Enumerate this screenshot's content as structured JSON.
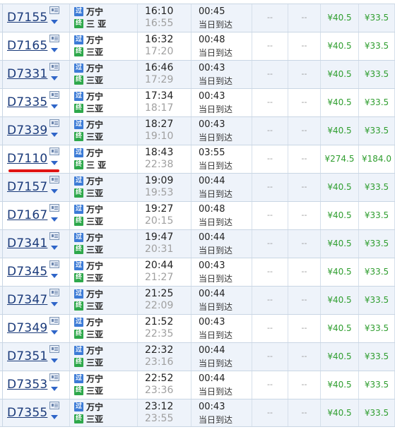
{
  "icons": {
    "card": "ticket-card-icon",
    "expand": "chevron-down-icon",
    "pass_badge": "过",
    "end_badge": "终"
  },
  "colors": {
    "train_link": "#1a3a7a",
    "price": "#2f9e2f",
    "arrival_time": "#a0a0a0",
    "highlight_underline": "#e01414",
    "badge_pass": "#3c7bd6",
    "badge_end": "#2ea84b"
  },
  "trains": [
    {
      "no": "D7155",
      "from": "万宁",
      "to": "三 亚",
      "dep": "16:10",
      "arr": "16:55",
      "dur": "00:45",
      "arr_day": "当日到达",
      "e1": "--",
      "e2": "--",
      "p1": "¥40.5",
      "p2": "¥33.5",
      "highlight": false
    },
    {
      "no": "D7165",
      "from": "万宁",
      "to": "三亚",
      "dep": "16:32",
      "arr": "17:20",
      "dur": "00:48",
      "arr_day": "当日到达",
      "e1": "--",
      "e2": "--",
      "p1": "¥40.5",
      "p2": "¥33.5",
      "highlight": false
    },
    {
      "no": "D7331",
      "from": "万宁",
      "to": "三亚",
      "dep": "16:46",
      "arr": "17:29",
      "dur": "00:43",
      "arr_day": "当日到达",
      "e1": "--",
      "e2": "--",
      "p1": "¥40.5",
      "p2": "¥33.5",
      "highlight": false
    },
    {
      "no": "D7335",
      "from": "万宁",
      "to": "三亚",
      "dep": "17:34",
      "arr": "18:17",
      "dur": "00:43",
      "arr_day": "当日到达",
      "e1": "--",
      "e2": "--",
      "p1": "¥40.5",
      "p2": "¥33.5",
      "highlight": false
    },
    {
      "no": "D7339",
      "from": "万宁",
      "to": "三亚",
      "dep": "18:27",
      "arr": "19:10",
      "dur": "00:43",
      "arr_day": "当日到达",
      "e1": "--",
      "e2": "--",
      "p1": "¥40.5",
      "p2": "¥33.5",
      "highlight": false
    },
    {
      "no": "D7110",
      "from": "万宁",
      "to": "三 亚",
      "dep": "18:43",
      "arr": "22:38",
      "dur": "03:55",
      "arr_day": "当日到达",
      "e1": "--",
      "e2": "--",
      "p1": "¥274.5",
      "p2": "¥184.0",
      "highlight": true
    },
    {
      "no": "D7157",
      "from": "万宁",
      "to": "三亚",
      "dep": "19:09",
      "arr": "19:53",
      "dur": "00:44",
      "arr_day": "当日到达",
      "e1": "--",
      "e2": "--",
      "p1": "¥40.5",
      "p2": "¥33.5",
      "highlight": false
    },
    {
      "no": "D7167",
      "from": "万宁",
      "to": "三亚",
      "dep": "19:27",
      "arr": "20:15",
      "dur": "00:48",
      "arr_day": "当日到达",
      "e1": "--",
      "e2": "--",
      "p1": "¥40.5",
      "p2": "¥33.5",
      "highlight": false
    },
    {
      "no": "D7341",
      "from": "万宁",
      "to": "三亚",
      "dep": "19:47",
      "arr": "20:31",
      "dur": "00:44",
      "arr_day": "当日到达",
      "e1": "--",
      "e2": "--",
      "p1": "¥40.5",
      "p2": "¥33.5",
      "highlight": false
    },
    {
      "no": "D7345",
      "from": "万宁",
      "to": "三亚",
      "dep": "20:44",
      "arr": "21:27",
      "dur": "00:43",
      "arr_day": "当日到达",
      "e1": "--",
      "e2": "--",
      "p1": "¥40.5",
      "p2": "¥33.5",
      "highlight": false
    },
    {
      "no": "D7347",
      "from": "万宁",
      "to": "三亚",
      "dep": "21:25",
      "arr": "22:09",
      "dur": "00:44",
      "arr_day": "当日到达",
      "e1": "--",
      "e2": "--",
      "p1": "¥40.5",
      "p2": "¥33.5",
      "highlight": false
    },
    {
      "no": "D7349",
      "from": "万宁",
      "to": "三亚",
      "dep": "21:52",
      "arr": "22:35",
      "dur": "00:43",
      "arr_day": "当日到达",
      "e1": "--",
      "e2": "--",
      "p1": "¥40.5",
      "p2": "¥33.5",
      "highlight": false
    },
    {
      "no": "D7351",
      "from": "万宁",
      "to": "三亚",
      "dep": "22:32",
      "arr": "23:16",
      "dur": "00:44",
      "arr_day": "当日到达",
      "e1": "--",
      "e2": "--",
      "p1": "¥40.5",
      "p2": "¥33.5",
      "highlight": false
    },
    {
      "no": "D7353",
      "from": "万宁",
      "to": "三亚",
      "dep": "22:52",
      "arr": "23:36",
      "dur": "00:44",
      "arr_day": "当日到达",
      "e1": "--",
      "e2": "--",
      "p1": "¥40.5",
      "p2": "¥33.5",
      "highlight": false
    },
    {
      "no": "D7355",
      "from": "万宁",
      "to": "三亚",
      "dep": "23:12",
      "arr": "23:55",
      "dur": "00:43",
      "arr_day": "当日到达",
      "e1": "--",
      "e2": "--",
      "p1": "¥40.5",
      "p2": "¥33.5",
      "highlight": false
    }
  ]
}
